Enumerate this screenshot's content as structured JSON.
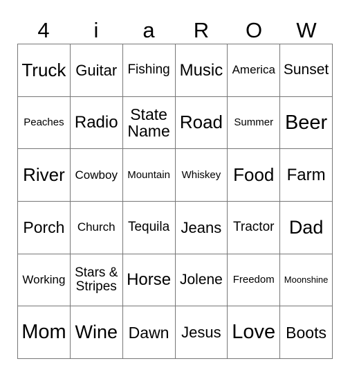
{
  "header": [
    "4",
    "i",
    "a",
    "R",
    "O",
    "W"
  ],
  "cells": [
    [
      "Truck",
      "Guitar",
      "Fishing",
      "Music",
      "America",
      "Sunset"
    ],
    [
      "Peaches",
      "Radio",
      "State Name",
      "Road",
      "Summer",
      "Beer"
    ],
    [
      "River",
      "Cowboy",
      "Mountain",
      "Whiskey",
      "Food",
      "Farm"
    ],
    [
      "Porch",
      "Church",
      "Tequila",
      "Jeans",
      "Tractor",
      "Dad"
    ],
    [
      "Working",
      "Stars & Stripes",
      "Horse",
      "Jolene",
      "Freedom",
      "Moonshine"
    ],
    [
      "Mom",
      "Wine",
      "Dawn",
      "Jesus",
      "Love",
      "Boots"
    ]
  ]
}
